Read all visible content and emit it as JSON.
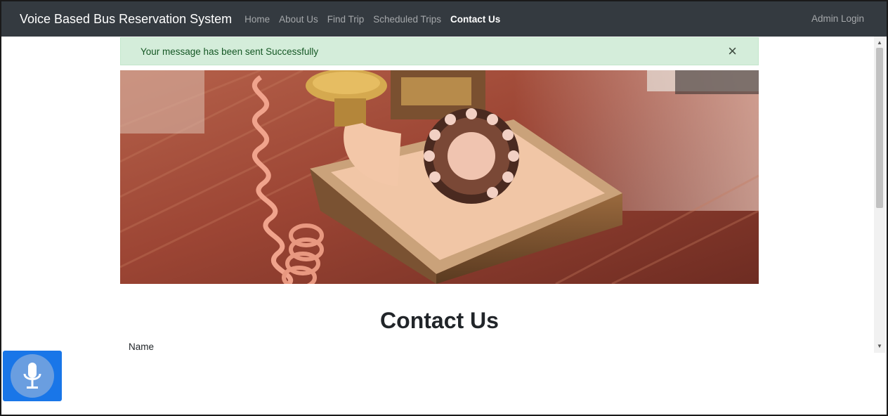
{
  "navbar": {
    "brand": "Voice Based Bus Reservation System",
    "links": [
      {
        "label": "Home",
        "active": false
      },
      {
        "label": "About Us",
        "active": false
      },
      {
        "label": "Find Trip",
        "active": false
      },
      {
        "label": "Scheduled Trips",
        "active": false
      },
      {
        "label": "Contact Us",
        "active": true
      }
    ],
    "admin": "Admin Login",
    "bg_color": "#343a40"
  },
  "alert": {
    "message": "Your message has been sent Successfully",
    "close_symbol": "×",
    "bg_color": "#d4edda"
  },
  "hero": {
    "icon": "rotary-telephone-photo"
  },
  "content": {
    "title": "Contact Us",
    "name_label": "Name"
  },
  "voice_button": {
    "icon": "microphone-icon",
    "bg_color": "#1976e8"
  },
  "scrollbar": {
    "up_symbol": "▲",
    "down_symbol": "▼"
  }
}
